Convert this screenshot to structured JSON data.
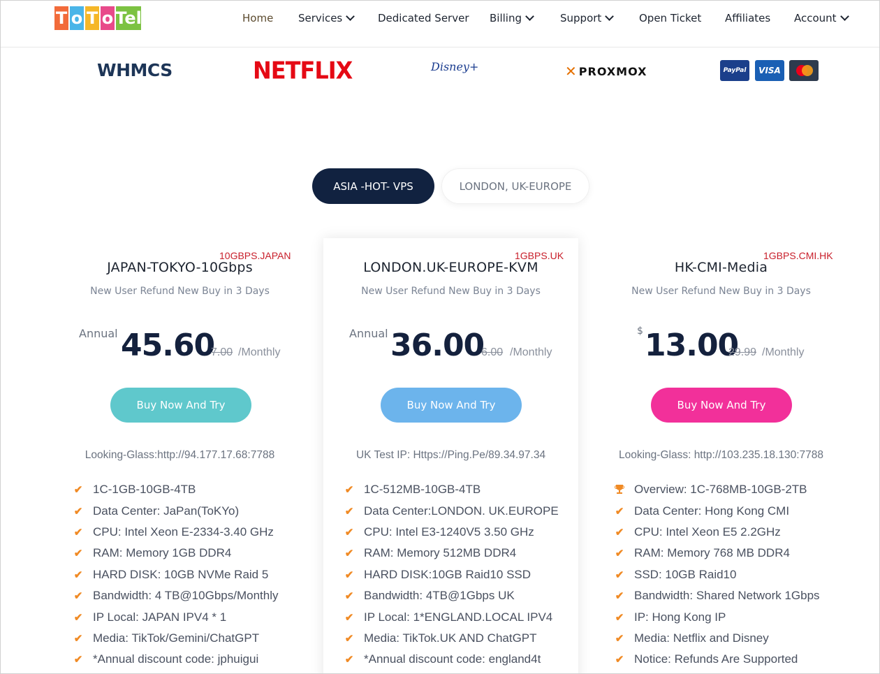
{
  "logo": {
    "letters": [
      "T",
      "o",
      "T",
      "o",
      "Tel"
    ],
    "colors": [
      "#f26b3a",
      "#4ab5e8",
      "#f5b728",
      "#e84a8a",
      "#7cc242"
    ]
  },
  "nav": {
    "items": [
      {
        "label": "Home",
        "dropdown": false,
        "active": true
      },
      {
        "label": "Services",
        "dropdown": true
      },
      {
        "label": "Dedicated Server",
        "dropdown": false
      },
      {
        "label": "Billing",
        "dropdown": true
      },
      {
        "label": "Support",
        "dropdown": true
      },
      {
        "label": "Open Ticket",
        "dropdown": false
      },
      {
        "label": "Affiliates",
        "dropdown": false
      },
      {
        "label": "Account",
        "dropdown": true
      }
    ]
  },
  "brands": {
    "whmcs": "WHMCS",
    "netflix": "NETFLIX",
    "disney": "Disney+",
    "proxmox": "PROXMOX",
    "paypal": "PayPal",
    "visa": "VISA"
  },
  "tabs": {
    "active": "ASIA -HOT- VPS",
    "inactive": "LONDON, UK-EUROPE"
  },
  "plans": [
    {
      "tag": "10GBPS.JAPAN",
      "title": "JAPAN-TOKYO-10Gbps",
      "subtitle": "New User Refund New Buy in 3 Days",
      "price_prefix": "Annual",
      "price": "45.60",
      "old_price": "7.00",
      "period": "/Monthly",
      "button": "Buy Now And Try",
      "button_color": "#5fc8cc",
      "looking_glass": "Looking-Glass:http://94.177.17.68:7788",
      "features": [
        "1C-1GB-10GB-4TB",
        "Data Center: JaPan(ToKYo)",
        "CPU: Intel Xeon E-2334-3.40 GHz",
        "RAM: Memory 1GB DDR4",
        "HARD DISK: 10GB NVMe Raid 5",
        "Bandwidth: 4 TB@10Gbps/Monthly",
        "IP Local: JAPAN IPV4 * 1",
        "Media: TikTok/Gemini/ChatGPT",
        "*Annual discount code: jphuigui"
      ]
    },
    {
      "tag": "1GBPS.UK",
      "title": "LONDON.UK-EUROPE-KVM",
      "subtitle": "New User Refund New Buy in 3 Days",
      "price_prefix": "Annual",
      "price": "36.00",
      "old_price": "6.00",
      "period": "/Monthly",
      "button": "Buy Now And Try",
      "button_color": "#6cb4ec",
      "looking_glass": "UK Test IP: Https://Ping.Pe/89.34.97.34",
      "features": [
        "1C-512MB-10GB-4TB",
        "Data Center:LONDON. UK.EUROPE",
        "CPU: Intel E3-1240V5 3.50 GHz",
        "RAM: Memory 512MB DDR4",
        "HARD DISK:10GB Raid10 SSD",
        "Bandwidth: 4TB@1Gbps UK",
        "IP Local: 1*ENGLAND.LOCAL IPV4",
        "Media: TikTok.UK AND ChatGPT",
        "*Annual discount code: england4t"
      ]
    },
    {
      "tag": "1GBPS.CMI.HK",
      "title": "HK-CMI-Media",
      "subtitle": "New User Refund New Buy in 3 Days",
      "price_prefix": "$",
      "price": "13.00",
      "old_price": "29.99",
      "period": "/Monthly",
      "button": "Buy Now And Try",
      "button_color": "#f2309a",
      "looking_glass": "Looking-Glass: http://103.235.18.130:7788",
      "features": [
        "Overview: 1C-768MB-10GB-2TB",
        "Data Center: Hong Kong CMI",
        "CPU: Intel Xeon E5 2.2GHz",
        "RAM: Memory 768 MB DDR4",
        "SSD: 10GB Raid10",
        "Bandwidth: Shared Network 1Gbps",
        "IP: Hong Kong IP",
        "Media: Netflix and Disney",
        "Notice: Refunds Are Supported"
      ]
    }
  ]
}
